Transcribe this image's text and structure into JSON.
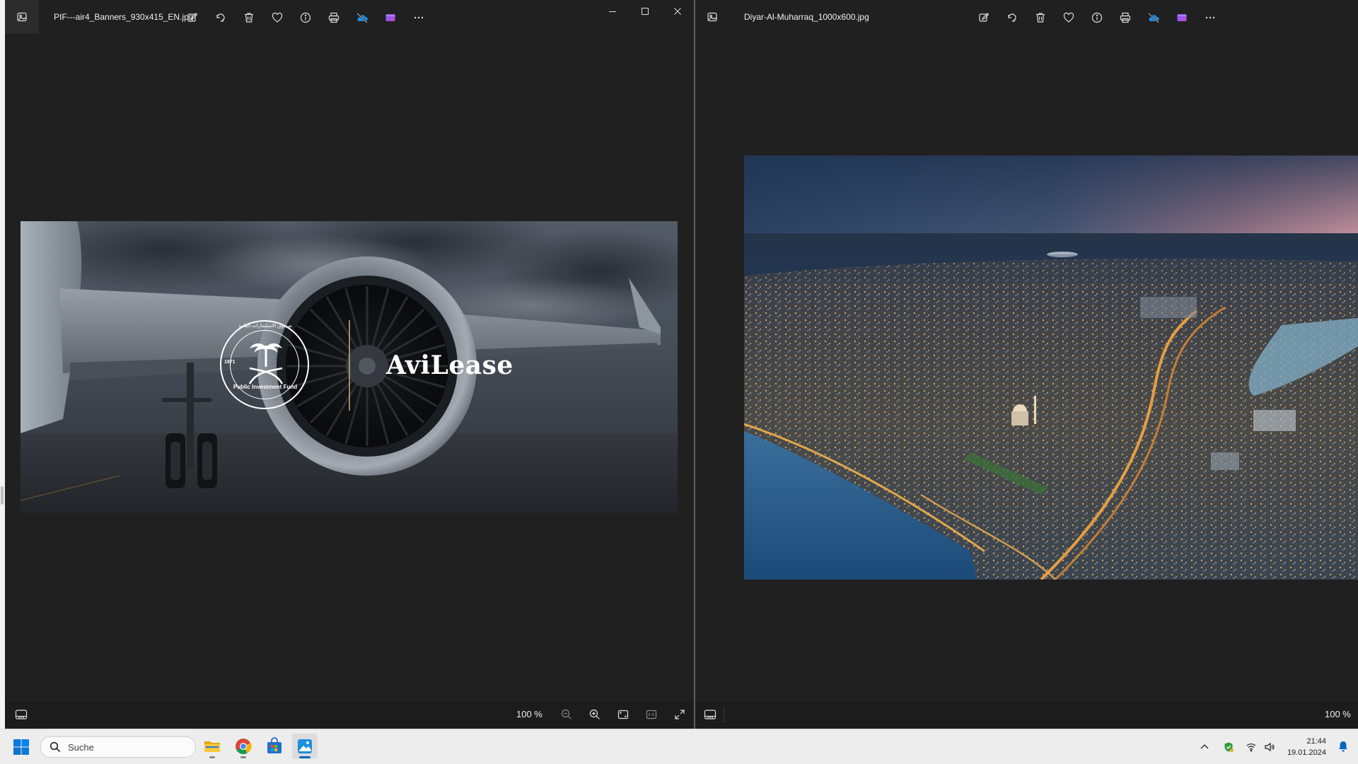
{
  "left_window": {
    "file_name": "PIF---air4_Banners_930x415_EN.jpg",
    "zoom": "100 %",
    "banner": {
      "brand": "AviLease",
      "seal_text": "Public Investment Fund",
      "seal_year": "1971",
      "seal_arabic": "صندوق الاستثمارات العامة"
    },
    "tools": [
      "edit-icon",
      "rotate-icon",
      "delete-icon",
      "favorite-icon",
      "info-icon",
      "print-icon",
      "onedrive-icon",
      "clipchamp-icon",
      "more-icon"
    ],
    "window_controls": [
      "minimize-icon",
      "maximize-icon",
      "close-icon"
    ]
  },
  "right_window": {
    "file_name": "Diyar-Al-Muharraq_1000x600.jpg",
    "zoom": "100 %",
    "tools": [
      "edit-icon",
      "rotate-icon",
      "delete-icon",
      "favorite-icon",
      "info-icon",
      "print-icon",
      "onedrive-icon",
      "clipchamp-icon",
      "more-icon"
    ]
  },
  "taskbar": {
    "search_placeholder": "Suche",
    "apps": [
      "file-explorer-icon",
      "chrome-icon",
      "store-icon",
      "photos-icon"
    ],
    "time": "21:44",
    "date": "19.01.2024"
  },
  "colors": {
    "window_bg": "#202020",
    "taskbar_bg": "#ededed",
    "accent": "#0067c0"
  }
}
